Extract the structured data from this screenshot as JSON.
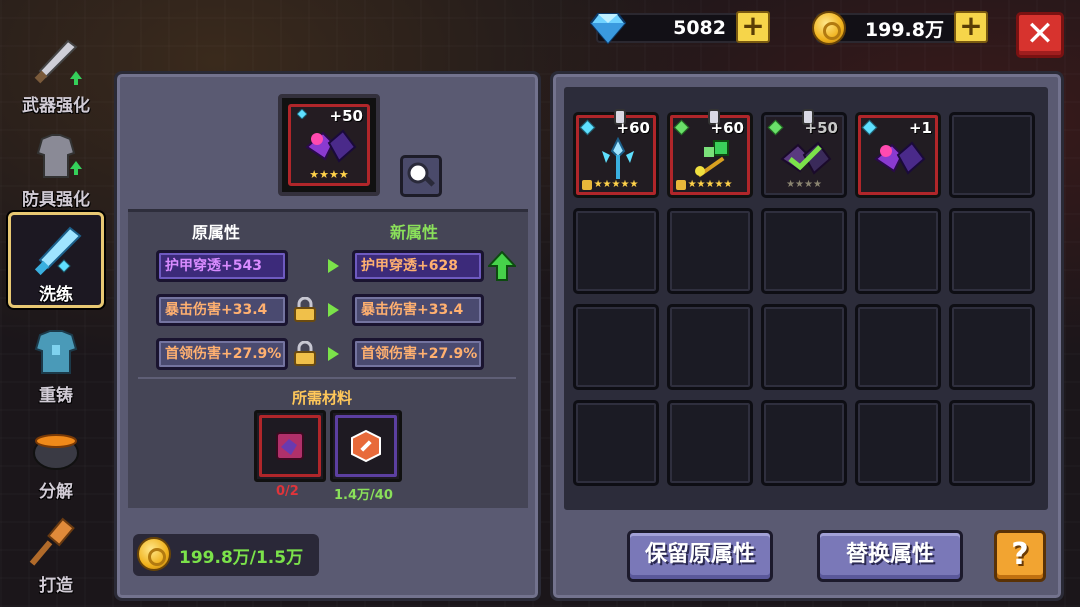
{
  "currency": {
    "gems": "5082",
    "coins": "199.8万"
  },
  "sidebar": {
    "items": [
      {
        "label": "武器强化",
        "icon": "sword-icon"
      },
      {
        "label": "防具强化",
        "icon": "armor-icon"
      },
      {
        "label": "洗练",
        "icon": "crystal-sword-icon"
      },
      {
        "label": "重铸",
        "icon": "chestplate-icon"
      },
      {
        "label": "分解",
        "icon": "cauldron-icon"
      },
      {
        "label": "打造",
        "icon": "hammer-icon"
      }
    ]
  },
  "item": {
    "level": "+50",
    "stars": "★★★★"
  },
  "attributes": {
    "old_header": "原属性",
    "new_header": "新属性",
    "rows": [
      {
        "old": "护甲穿透+543",
        "new": "护甲穿透+628"
      },
      {
        "old": "暴击伤害+33.4",
        "new": "暴击伤害+33.4"
      },
      {
        "old": "首领伤害+27.9%",
        "new": "首领伤害+27.9%"
      }
    ]
  },
  "materials": {
    "title": "所需材料",
    "items": [
      {
        "count": "0/2",
        "color": "#e0343a"
      },
      {
        "count": "1.4万/40",
        "color": "#8ae05a"
      }
    ]
  },
  "cost": "199.8万/1.5万",
  "inventory": {
    "items": [
      {
        "level": "+60",
        "stars": "★★★★★"
      },
      {
        "level": "+60",
        "stars": "★★★★★"
      },
      {
        "level": "+50",
        "stars": "★★★★"
      },
      {
        "level": "+1",
        "stars": ""
      }
    ]
  },
  "buttons": {
    "keep": "保留原属性",
    "replace": "替换属性",
    "help": "?",
    "close": "✕"
  }
}
